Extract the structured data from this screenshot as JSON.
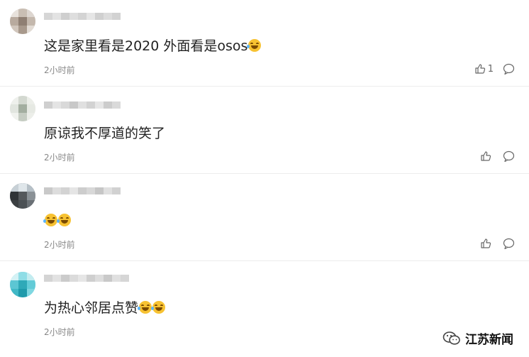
{
  "comments": [
    {
      "text": "这是家里看是2020 外面看是osos",
      "emojis": 1,
      "time": "2小时前",
      "likes": "1"
    },
    {
      "text": "原谅我不厚道的笑了",
      "emojis": 0,
      "time": "2小时前",
      "likes": ""
    },
    {
      "text": "",
      "emojis": 2,
      "time": "2小时前",
      "likes": ""
    },
    {
      "text": "为热心邻居点赞",
      "emojis": 2,
      "time": "2小时前",
      "likes": ""
    }
  ],
  "watermark": {
    "label": "江苏新闻",
    "icon": "wechat-icon"
  },
  "colors": {
    "emoji": "#f7c232",
    "divider": "#ececec",
    "time": "#888888",
    "text": "#222222"
  }
}
